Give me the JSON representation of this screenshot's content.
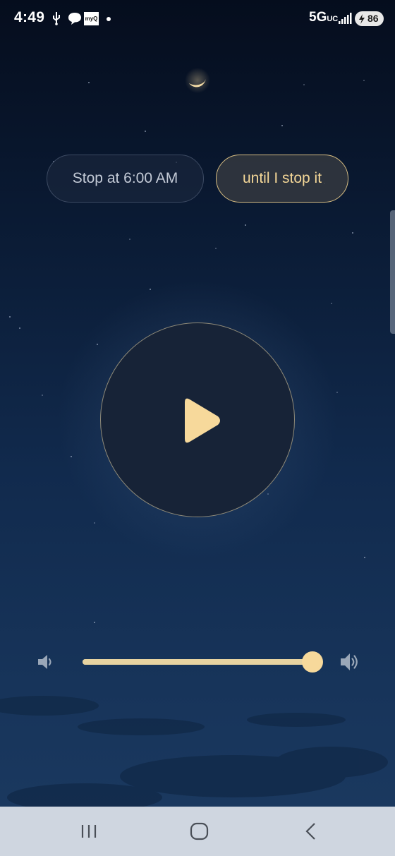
{
  "status_bar": {
    "time": "4:49",
    "network": "5G",
    "network_suffix": "UC",
    "battery_level": "86",
    "icons": [
      "usb-icon",
      "messages-icon",
      "myq-icon",
      "notification-dot-icon",
      "signal-icon",
      "battery-charging-icon"
    ],
    "myq_label": "myQ"
  },
  "timer_options": {
    "stop_at_label": "Stop at 6:00 AM",
    "until_stop_label": "until I stop it",
    "selected": "until I stop it"
  },
  "player": {
    "state": "paused",
    "icon": "play-icon"
  },
  "volume": {
    "level": 1.0,
    "low_icon": "volume-low-icon",
    "high_icon": "volume-high-icon"
  },
  "nav_bar": {
    "buttons": [
      "recent-apps-icon",
      "home-icon",
      "back-icon"
    ]
  },
  "colors": {
    "accent": "#f7d99b",
    "background_top": "#050d1d",
    "background_bottom": "#1b3a61"
  }
}
